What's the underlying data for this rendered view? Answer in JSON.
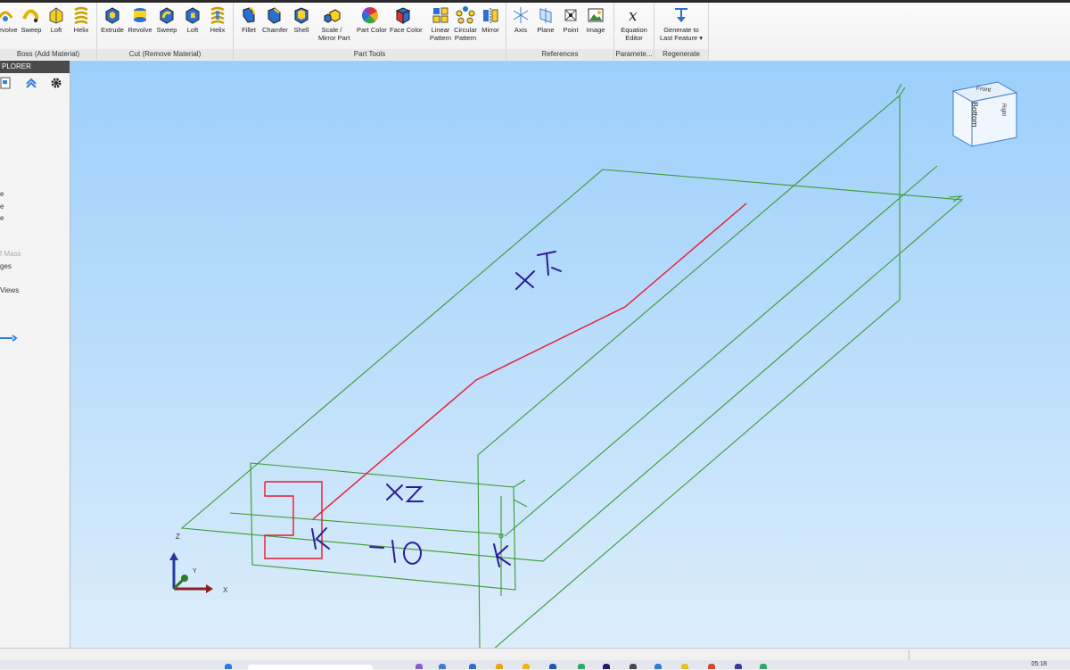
{
  "ribbon": {
    "groups": [
      {
        "label": "Boss (Add Material)",
        "tools": [
          {
            "label": "Revolve",
            "icon": "revolve-icon"
          },
          {
            "label": "Sweep",
            "icon": "sweep-icon"
          },
          {
            "label": "Loft",
            "icon": "loft-icon"
          },
          {
            "label": "Helix",
            "icon": "helix-icon"
          }
        ]
      },
      {
        "label": "Cut (Remove Material)",
        "tools": [
          {
            "label": "Extrude",
            "icon": "extrude-cut-icon"
          },
          {
            "label": "Revolve",
            "icon": "revolve-cut-icon"
          },
          {
            "label": "Sweep",
            "icon": "sweep-cut-icon"
          },
          {
            "label": "Loft",
            "icon": "loft-cut-icon"
          },
          {
            "label": "Helix",
            "icon": "helix-cut-icon"
          }
        ]
      },
      {
        "label": "Part Tools",
        "tools": [
          {
            "label": "Fillet",
            "icon": "fillet-icon"
          },
          {
            "label": "Chamfer",
            "icon": "chamfer-icon"
          },
          {
            "label": "Shell",
            "icon": "shell-icon"
          },
          {
            "label": "Scale /",
            "label2": "Mirror Part",
            "icon": "scale-mirror-icon"
          },
          {
            "label": "Part Color",
            "icon": "part-color-icon"
          },
          {
            "label": "Face Color",
            "icon": "face-color-icon"
          },
          {
            "label": "Linear",
            "label2": "Pattern",
            "icon": "linear-pattern-icon"
          },
          {
            "label": "Circular",
            "label2": "Pattern",
            "icon": "circular-pattern-icon"
          },
          {
            "label": "Mirror",
            "icon": "mirror-icon"
          }
        ]
      },
      {
        "label": "References",
        "tools": [
          {
            "label": "Axis",
            "icon": "axis-icon"
          },
          {
            "label": "Plane",
            "icon": "plane-icon"
          },
          {
            "label": "Point",
            "icon": "point-icon"
          },
          {
            "label": "Image",
            "icon": "image-icon"
          }
        ]
      },
      {
        "label": "Paramete...",
        "tools": [
          {
            "label": "Equation",
            "label2": "Editor",
            "icon": "equation-editor-icon"
          }
        ]
      },
      {
        "label": "Regenerate",
        "tools": [
          {
            "label": "Generate to",
            "label2": "Last Feature ▾",
            "icon": "generate-icon"
          }
        ]
      }
    ]
  },
  "sidebar": {
    "header": "PLORER",
    "items": [
      {
        "label": "e",
        "dim": false
      },
      {
        "label": "e",
        "dim": false
      },
      {
        "label": "e",
        "dim": false
      },
      {
        "label": "f Mass",
        "dim": true
      },
      {
        "label": "ges",
        "dim": false
      },
      {
        "label": "Views",
        "dim": false
      }
    ]
  },
  "viewport": {
    "view_cube": {
      "front": "Front",
      "bottom": "Bottom",
      "side": "Right"
    },
    "annotations": {
      "xy": "X Y",
      "xz": "XZ",
      "offset": "-10",
      "k1": "K",
      "k2": "K"
    },
    "triad": {
      "x": "X",
      "y": "Y",
      "z": "Z"
    }
  },
  "taskbar": {
    "clock": "05:18"
  },
  "colors": {
    "plane": "#3b9b2f",
    "path": "#e8192c",
    "handwriting": "#2b1d96",
    "viewport_top": "#9ccffb"
  }
}
